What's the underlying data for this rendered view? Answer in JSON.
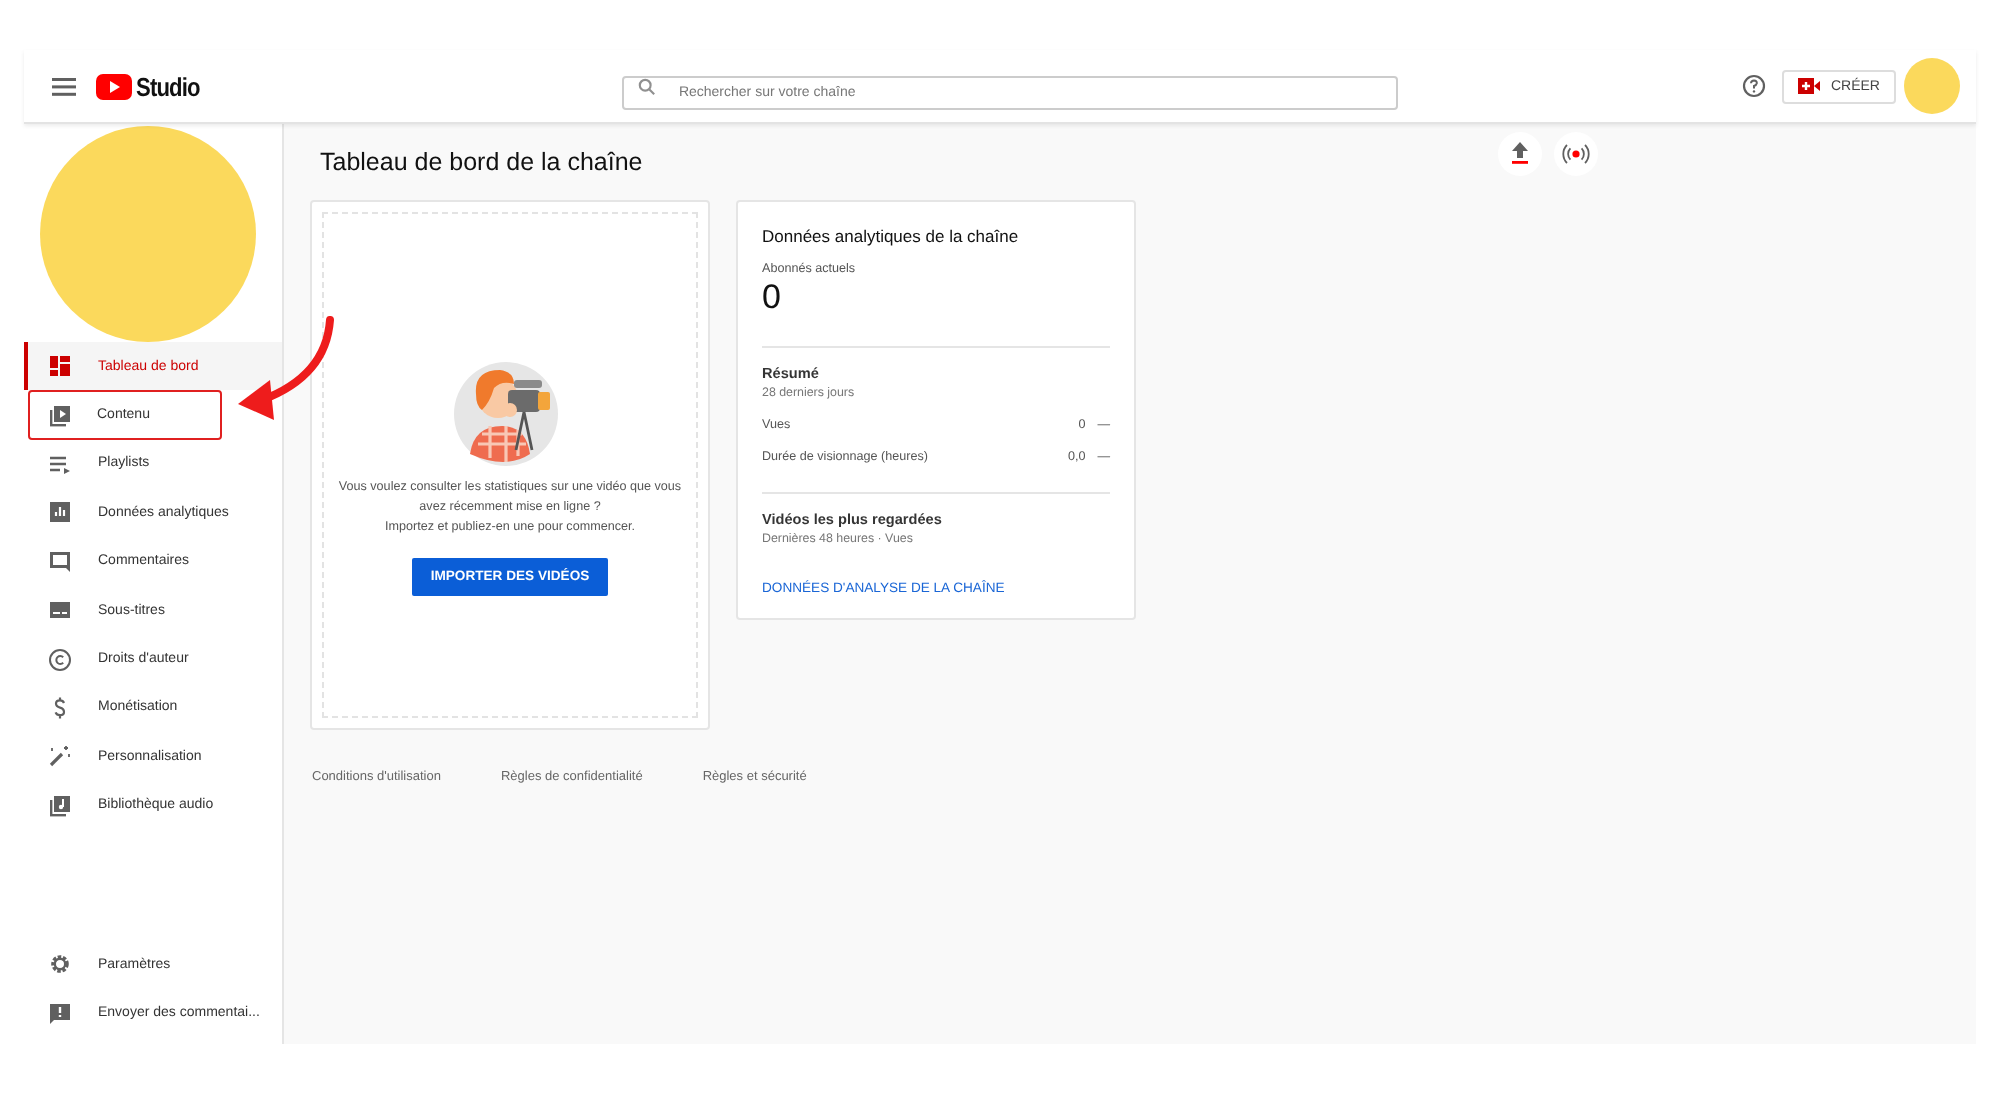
{
  "header": {
    "logo_text": "Studio",
    "search": {
      "placeholder": "Rechercher sur votre chaîne"
    },
    "create_button": "CRÉER"
  },
  "sidebar": {
    "items": [
      {
        "label": "Tableau de bord",
        "selected": true,
        "highlighted": false
      },
      {
        "label": "Contenu",
        "selected": false,
        "highlighted": true
      },
      {
        "label": "Playlists",
        "selected": false,
        "highlighted": false
      },
      {
        "label": "Données analytiques",
        "selected": false,
        "highlighted": false
      },
      {
        "label": "Commentaires",
        "selected": false,
        "highlighted": false
      },
      {
        "label": "Sous-titres",
        "selected": false,
        "highlighted": false
      },
      {
        "label": "Droits d'auteur",
        "selected": false,
        "highlighted": false
      },
      {
        "label": "Monétisation",
        "selected": false,
        "highlighted": false
      },
      {
        "label": "Personnalisation",
        "selected": false,
        "highlighted": false
      },
      {
        "label": "Bibliothèque audio",
        "selected": false,
        "highlighted": false
      }
    ],
    "bottom_items": [
      {
        "label": "Paramètres"
      },
      {
        "label": "Envoyer des commentai..."
      }
    ]
  },
  "main": {
    "title": "Tableau de bord de la chaîne",
    "upload_card": {
      "lines": [
        "Vous voulez consulter les statistiques sur une vidéo que vous avez récemment mise en ligne ?",
        "Importez et publiez-en une pour commencer."
      ],
      "button": "IMPORTER DES VIDÉOS"
    },
    "analytics_card": {
      "title": "Données analytiques de la chaîne",
      "subscribers_label": "Abonnés actuels",
      "subscribers": "0",
      "summary_title": "Résumé",
      "summary_period": "28 derniers jours",
      "metrics": [
        {
          "label": "Vues",
          "value": "0",
          "trend": "—"
        },
        {
          "label": "Durée de visionnage (heures)",
          "value": "0,0",
          "trend": "—"
        }
      ],
      "top_title": "Vidéos les plus regardées",
      "top_period": "Dernières 48 heures · Vues",
      "link": "DONNÉES D'ANALYSE DE LA CHAÎNE"
    },
    "footer_links": [
      "Conditions d'utilisation",
      "Règles de confidentialité",
      "Règles et sécurité"
    ]
  }
}
